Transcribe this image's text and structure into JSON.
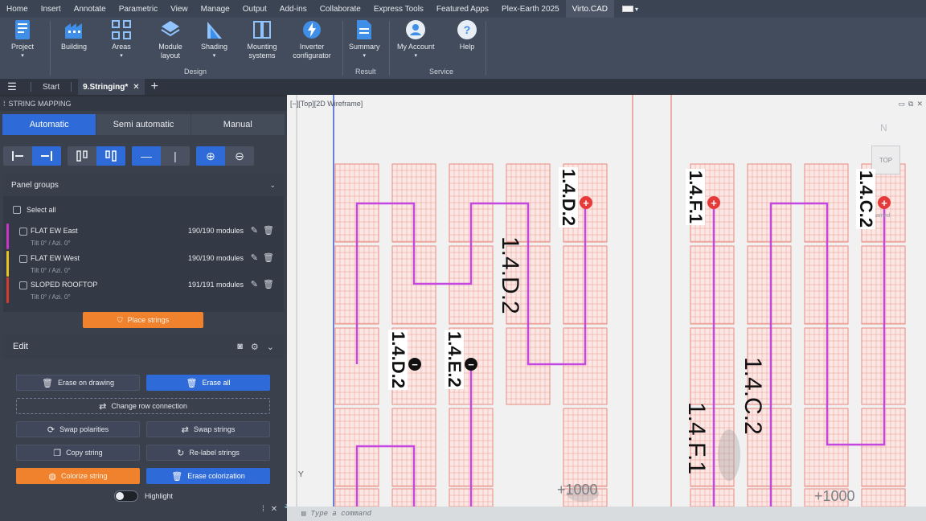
{
  "ribbon_tabs": [
    "Home",
    "Insert",
    "Annotate",
    "Parametric",
    "View",
    "Manage",
    "Output",
    "Add-ins",
    "Collaborate",
    "Express Tools",
    "Featured Apps",
    "Plex-Earth 2025",
    "Virto.CAD"
  ],
  "ribbon_active_tab": "Virto.CAD",
  "ribbon": {
    "project": "Project",
    "building": "Building",
    "areas": "Areas",
    "module_layout": "Module layout",
    "shading": "Shading",
    "mounting_systems": "Mounting systems",
    "inverter_configurator": "Inverter configurator",
    "summary": "Summary",
    "my_account": "My Account",
    "help": "Help",
    "group_design": "Design",
    "group_result": "Result",
    "group_service": "Service"
  },
  "doc_tabs": {
    "start": "Start",
    "active": "9.Stringing*"
  },
  "palette": {
    "title": "STRING MAPPING",
    "mode_tabs": [
      "Automatic",
      "Semi automatic",
      "Manual"
    ],
    "active_mode": "Automatic",
    "panel_groups_title": "Panel groups",
    "select_all": "Select all",
    "groups": [
      {
        "name": "FLAT EW East",
        "sub": "Tilt 0° / Azi. 0°",
        "modules": "190/190 modules",
        "color": "#c934c9"
      },
      {
        "name": "FLAT EW West",
        "sub": "Tilt 0° / Azi. 0°",
        "modules": "190/190 modules",
        "color": "#e8c320"
      },
      {
        "name": "SLOPED ROOFTOP",
        "sub": "Tilt 0° / Azi. 0°",
        "modules": "191/191 modules",
        "color": "#d63a2a"
      }
    ],
    "place_strings": "Place strings",
    "edit_title": "Edit",
    "buttons": {
      "erase_on_drawing": "Erase on drawing",
      "erase_all": "Erase all",
      "change_row_connection": "Change row connection",
      "swap_polarities": "Swap polarities",
      "swap_strings": "Swap strings",
      "copy_string": "Copy string",
      "relabel_strings": "Re-label strings",
      "colorize_string": "Colorize string",
      "erase_colorization": "Erase colorization"
    },
    "highlight": "Highlight",
    "highlight_on": false
  },
  "viewport": {
    "label": "[−][Top][2D Wireframe]",
    "viewcube_label": "TOP",
    "compass": "N",
    "unnamed": "Unnamed",
    "axis_y": "Y",
    "dim_text": "+1000",
    "string_labels_small": [
      "1.4.D.2",
      "1.4.F.1",
      "1.4.C.2",
      "1.4.D.2",
      "1.4.E.2"
    ],
    "string_labels_large": [
      "1.4.D.2",
      "1.4.C.2",
      "1.4.F.1"
    ],
    "string_color": "#c447e0",
    "panel_grid_color": "#e98a80"
  },
  "command": {
    "placeholder": "Type a command"
  }
}
